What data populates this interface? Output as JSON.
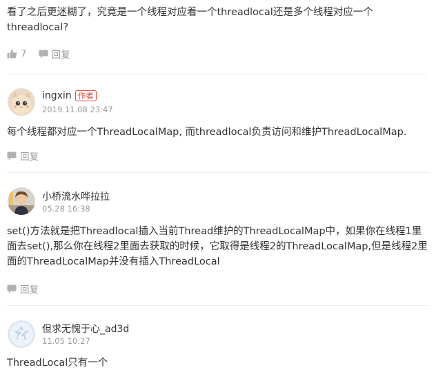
{
  "top_comment": {
    "text": "看了之后更迷糊了，究竟是一个线程对应着一个threadlocal还是多个线程对应一个threadlocal?",
    "like_count": "7",
    "reply_label": "回复"
  },
  "replies": [
    {
      "username": "ingxin",
      "badge": "作者",
      "date": "2019.11.08 23:47",
      "text": "每个线程都对应一个ThreadLocalMap, 而threadlocal负责访问和维护ThreadLocalMap.",
      "reply_label": "回复"
    },
    {
      "username": "小桥流水哗拉拉",
      "date": "05.28 16:38",
      "text": "set()方法就是把Threadlocal插入当前Thread维护的ThreadLocalMap中，如果你在线程1里面去set(),那么你在线程2里面去获取的时候，它取得是线程2的ThreadLocalMap,但是线程2里面的ThreadLocalMap并没有插入ThreadLocal",
      "reply_label": "回复"
    },
    {
      "username": "但求无愧于心_ad3d",
      "date": "11.05 10:27",
      "text": "ThreadLocal只有一个"
    }
  ]
}
